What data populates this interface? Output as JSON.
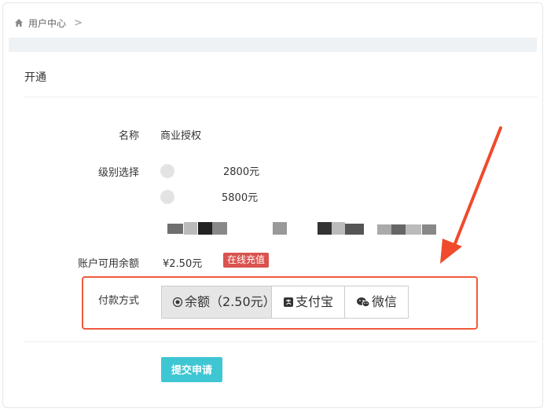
{
  "breadcrumb": {
    "home_icon": "home-icon",
    "item": "用户中心",
    "separator": ">"
  },
  "section": {
    "title": "开通"
  },
  "form": {
    "name_label": "名称",
    "name_value": "商业授权",
    "level_label": "级别选择",
    "levels": [
      {
        "text": "2800元",
        "selected": false
      },
      {
        "text": "5800元",
        "selected": false
      }
    ],
    "balance_label": "账户可用余额",
    "balance_value": "¥2.50元",
    "recharge_label": "在线充值",
    "pay_label": "付款方式",
    "pay_options": [
      {
        "label": "余额（2.50元）",
        "icon": "radio-dot-icon",
        "selected": true
      },
      {
        "label": "支付宝",
        "icon": "alipay-icon",
        "selected": false
      },
      {
        "label": "微信",
        "icon": "wechat-icon",
        "selected": false
      }
    ],
    "submit_label": "提交申请"
  },
  "colors": {
    "accent": "#3ec7d3",
    "recharge": "#d9534f",
    "highlight": "#f05a3c"
  }
}
